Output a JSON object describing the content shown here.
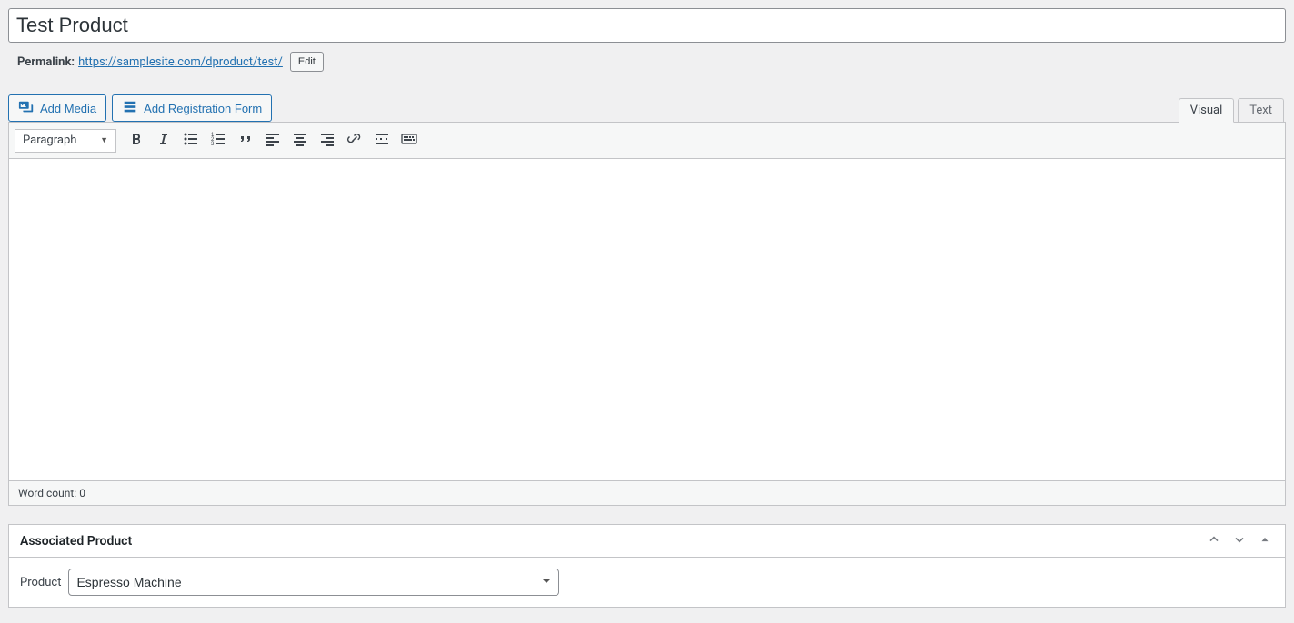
{
  "title_value": "Test Product",
  "permalink": {
    "label": "Permalink:",
    "url_text": "https://samplesite.com/dproduct/test/",
    "edit_label": "Edit"
  },
  "media_buttons": {
    "add_media": "Add Media",
    "add_registration_form": "Add Registration Form"
  },
  "editor_tabs": {
    "visual": "Visual",
    "text": "Text"
  },
  "toolbar": {
    "format_select": "Paragraph"
  },
  "status_bar": {
    "word_count_label": "Word count:",
    "word_count_value": "0"
  },
  "associated_product_box": {
    "title": "Associated Product",
    "field_label": "Product",
    "selected_option": "Espresso Machine"
  }
}
